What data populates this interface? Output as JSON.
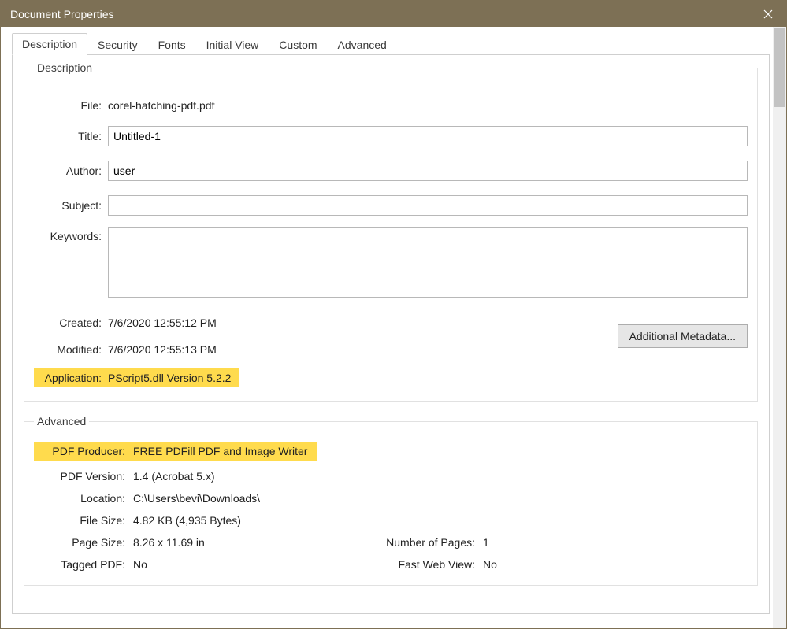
{
  "window": {
    "title": "Document Properties"
  },
  "tabs": {
    "description": "Description",
    "security": "Security",
    "fonts": "Fonts",
    "initial_view": "Initial View",
    "custom": "Custom",
    "advanced": "Advanced"
  },
  "description_group": {
    "legend": "Description",
    "file_label": "File:",
    "file_value": "corel-hatching-pdf.pdf",
    "title_label": "Title:",
    "title_value": "Untitled-1",
    "author_label": "Author:",
    "author_value": "user",
    "subject_label": "Subject:",
    "subject_value": "",
    "keywords_label": "Keywords:",
    "keywords_value": "",
    "created_label": "Created:",
    "created_value": "7/6/2020 12:55:12 PM",
    "modified_label": "Modified:",
    "modified_value": "7/6/2020 12:55:13 PM",
    "application_label": "Application:",
    "application_value": "PScript5.dll Version 5.2.2",
    "metadata_button": "Additional Metadata..."
  },
  "advanced_group": {
    "legend": "Advanced",
    "producer_label": "PDF Producer:",
    "producer_value": "FREE PDFill PDF and Image Writer",
    "version_label": "PDF Version:",
    "version_value": "1.4 (Acrobat 5.x)",
    "location_label": "Location:",
    "location_value": "C:\\Users\\bevi\\Downloads\\",
    "filesize_label": "File Size:",
    "filesize_value": "4.82 KB (4,935 Bytes)",
    "pagesize_label": "Page Size:",
    "pagesize_value": "8.26 x 11.69 in",
    "numpages_label": "Number of Pages:",
    "numpages_value": "1",
    "tagged_label": "Tagged PDF:",
    "tagged_value": "No",
    "fastweb_label": "Fast Web View:",
    "fastweb_value": "No"
  }
}
